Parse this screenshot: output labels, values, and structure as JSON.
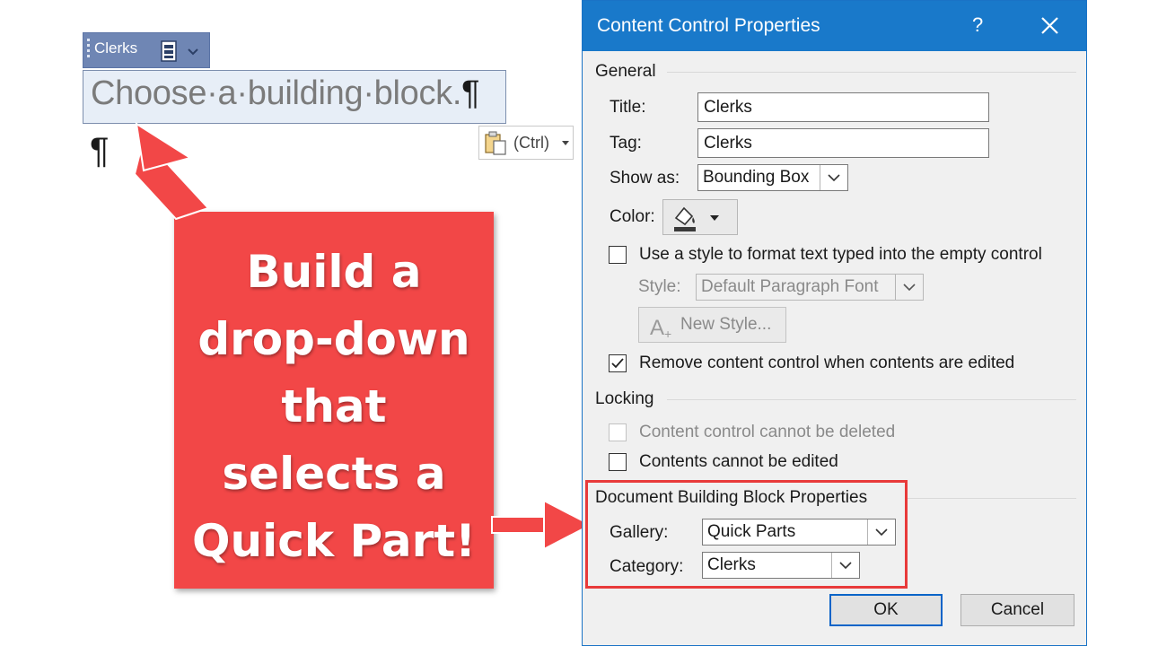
{
  "document": {
    "tag_title": "Clerks",
    "placeholder": "Choose·a·building·block.",
    "pilcrow": "¶",
    "paste_label": "(Ctrl)"
  },
  "callout": {
    "text_lines": [
      "Build a",
      "drop-down",
      "that",
      "selects a",
      "Quick Part!"
    ],
    "color": "#f24747"
  },
  "dialog": {
    "title": "Content Control Properties",
    "help": "?",
    "general": {
      "heading": "General",
      "title_label": "Title:",
      "title_value": "Clerks",
      "tag_label": "Tag:",
      "tag_value": "Clerks",
      "show_as_label": "Show as:",
      "show_as_value": "Bounding Box",
      "color_label": "Color:",
      "use_style_label": "Use a style to format text typed into the empty control",
      "use_style_checked": false,
      "style_label": "Style:",
      "style_value": "Default Paragraph Font",
      "new_style_label": "New Style...",
      "remove_cc_label": "Remove content control when contents are edited",
      "remove_cc_checked": true
    },
    "locking": {
      "heading": "Locking",
      "cannot_delete_label": "Content control cannot be deleted",
      "cannot_delete_checked": false,
      "cannot_edit_label": "Contents cannot be edited",
      "cannot_edit_checked": false
    },
    "building_block": {
      "heading": "Document Building Block Properties",
      "gallery_label": "Gallery:",
      "gallery_value": "Quick Parts",
      "category_label": "Category:",
      "category_value": "Clerks"
    },
    "ok_label": "OK",
    "cancel_label": "Cancel",
    "accent_color": "#1979ca",
    "highlight_color": "#e83a3a"
  }
}
